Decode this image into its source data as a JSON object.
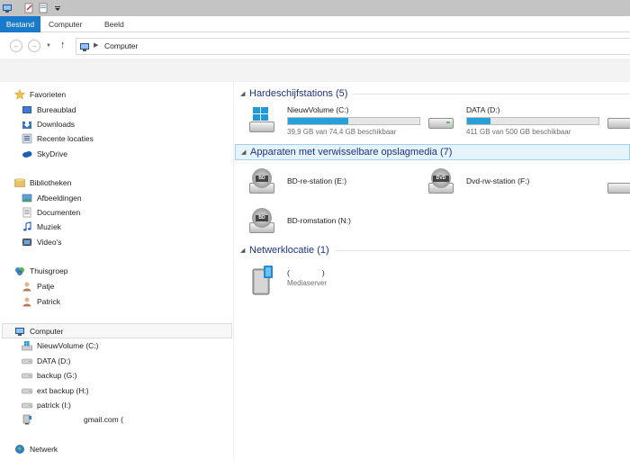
{
  "ribbon": {
    "tabs": [
      "Bestand",
      "Computer",
      "Beeld"
    ]
  },
  "address": {
    "location": "Computer"
  },
  "nav": {
    "favorites": {
      "label": "Favorieten",
      "items": [
        "Bureaublad",
        "Downloads",
        "Recente locaties",
        "SkyDrive"
      ]
    },
    "libraries": {
      "label": "Bibliotheken",
      "items": [
        "Afbeeldingen",
        "Documenten",
        "Muziek",
        "Video's"
      ]
    },
    "homegroup": {
      "label": "Thuisgroep",
      "items": [
        "Patje",
        "Patrick"
      ]
    },
    "computer": {
      "label": "Computer",
      "items": [
        "NieuwVolume (C:)",
        "DATA (D:)",
        "backup (G:)",
        "ext backup (H:)",
        "patrick (I:)",
        "gmail.com ("
      ]
    },
    "network": {
      "label": "Netwerk"
    }
  },
  "content": {
    "groups": [
      {
        "title": "Hardeschijfstations (5)"
      },
      {
        "title": "Apparaten met verwisselbare opslagmedia (7)"
      },
      {
        "title": "Netwerklocatie (1)"
      }
    ],
    "hard_drives": [
      {
        "name": "NieuwVolume (C:)",
        "free_text": "39,9 GB van 74,4 GB beschikbaar",
        "used_fraction": 0.46
      },
      {
        "name": "DATA (D:)",
        "free_text": "411 GB van 500 GB beschikbaar",
        "used_fraction": 0.18
      }
    ],
    "removable": [
      {
        "name": "BD-re-station (E:)",
        "badge": "BD"
      },
      {
        "name": "Dvd-rw-station (F:)",
        "badge": "DVD"
      },
      {
        "name": "BD-romstation (N:)",
        "badge": "BD"
      }
    ],
    "network": [
      {
        "name": "(",
        "suffix": ")",
        "sub": "Mediaserver"
      }
    ]
  },
  "colors": {
    "accent": "#1979ca",
    "bar_fill": "#26a0da",
    "group_text": "#1e3287"
  }
}
